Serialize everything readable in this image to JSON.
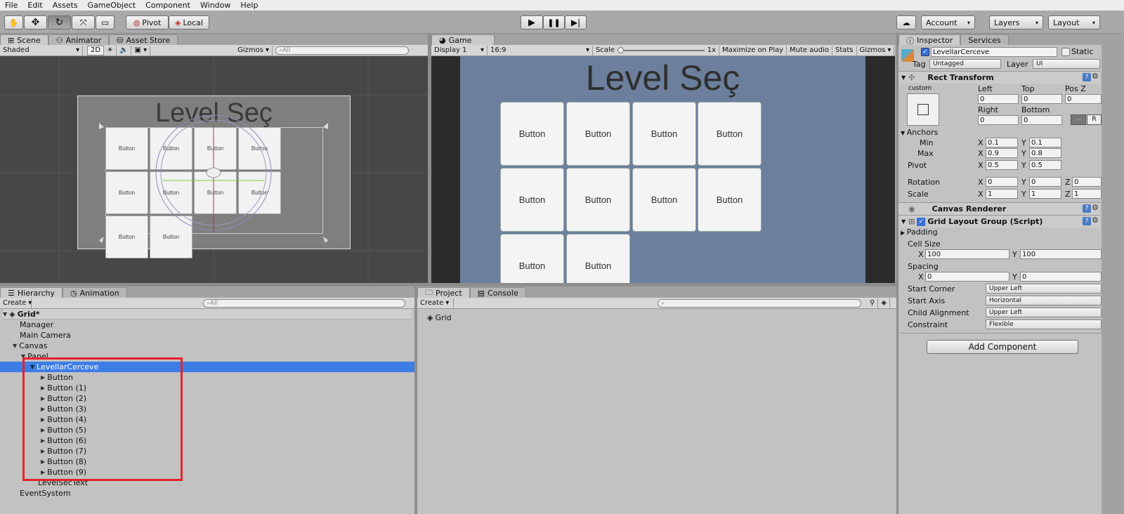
{
  "menu": [
    "File",
    "Edit",
    "Assets",
    "GameObject",
    "Component",
    "Window",
    "Help"
  ],
  "toolbar": {
    "pivot": "Pivot",
    "local": "Local",
    "account": "Account",
    "layers": "Layers",
    "layout": "Layout"
  },
  "scene": {
    "tabs": [
      "Scene",
      "Animator",
      "Asset Store"
    ],
    "shading": "Shaded",
    "mode2d": "2D",
    "gizmos": "Gizmos",
    "search_placeholder": "All",
    "title": "Level Seç",
    "buttons": [
      "Button",
      "Button",
      "Button",
      "Button",
      "Button",
      "Button",
      "Button",
      "Button",
      "Button",
      "Button"
    ]
  },
  "game": {
    "tab": "Game",
    "display": "Display 1",
    "aspect": "16:9",
    "scale_label": "Scale",
    "scale_value": "1x",
    "maximize": "Maximize on Play",
    "mute": "Mute audio",
    "stats": "Stats",
    "gizmos": "Gizmos",
    "title": "Level Seç",
    "buttons": [
      "Button",
      "Button",
      "Button",
      "Button",
      "Button",
      "Button",
      "Button",
      "Button",
      "Button",
      "Button"
    ]
  },
  "hierarchy": {
    "tabs": [
      "Hierarchy",
      "Animation"
    ],
    "create": "Create",
    "search_placeholder": "All",
    "scene_name": "Grid*",
    "items": [
      {
        "label": "Manager"
      },
      {
        "label": "Main Camera"
      },
      {
        "label": "Canvas"
      },
      {
        "label": "Panel"
      },
      {
        "label": "LevellarCerceve"
      },
      {
        "label": "Button"
      },
      {
        "label": "Button (1)"
      },
      {
        "label": "Button (2)"
      },
      {
        "label": "Button (3)"
      },
      {
        "label": "Button (4)"
      },
      {
        "label": "Button (5)"
      },
      {
        "label": "Button (6)"
      },
      {
        "label": "Button (7)"
      },
      {
        "label": "Button (8)"
      },
      {
        "label": "Button (9)"
      },
      {
        "label": "LevelSecText"
      },
      {
        "label": "EventSystem"
      }
    ],
    "highlight_color": "#e8222a",
    "selection_color": "#3d7de6"
  },
  "project": {
    "tabs": [
      "Project",
      "Console"
    ],
    "create": "Create",
    "asset": "Grid"
  },
  "inspector": {
    "tabs": [
      "Inspector",
      "Services"
    ],
    "name": "LevellarCerceve",
    "static": "Static",
    "tag_label": "Tag",
    "tag": "Untagged",
    "layer_label": "Layer",
    "layer": "UI",
    "rect_transform": "Rect Transform",
    "custom": "custom",
    "col_left": "Left",
    "col_top": "Top",
    "col_posz": "Pos Z",
    "left": "0",
    "top": "0",
    "posz": "0",
    "col_right": "Right",
    "col_bottom": "Bottom",
    "right": "0",
    "bottom": "0",
    "anchors": "Anchors",
    "min": "Min",
    "max": "Max",
    "pivot": "Pivot",
    "min_x": "0.1",
    "min_y": "0.1",
    "max_x": "0.9",
    "max_y": "0.8",
    "pivot_x": "0.5",
    "pivot_y": "0.5",
    "rotation": "Rotation",
    "rot_x": "0",
    "rot_y": "0",
    "rot_z": "0",
    "scale": "Scale",
    "sc_x": "1",
    "sc_y": "1",
    "sc_z": "1",
    "canvas_renderer": "Canvas Renderer",
    "grid_layout": "Grid Layout Group (Script)",
    "padding": "Padding",
    "cell_size": "Cell Size",
    "cell_x": "100",
    "cell_y": "100",
    "spacing": "Spacing",
    "sp_x": "0",
    "sp_y": "0",
    "start_corner": "Start Corner",
    "start_corner_val": "Upper Left",
    "start_axis": "Start Axis",
    "start_axis_val": "Horizontal",
    "child_alignment": "Child Alignment",
    "child_alignment_val": "Upper Left",
    "constraint": "Constraint",
    "constraint_val": "Flexible",
    "add_component": "Add Component",
    "x": "X",
    "y": "Y",
    "z": "Z",
    "r": "R"
  }
}
